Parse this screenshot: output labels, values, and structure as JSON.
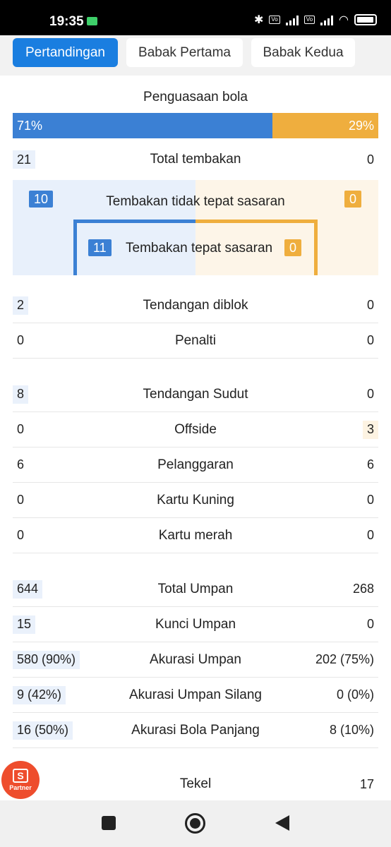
{
  "status_bar": {
    "time": "19:35"
  },
  "tabs": [
    {
      "label": "Pertandingan"
    },
    {
      "label": "Babak Pertama"
    },
    {
      "label": "Babak Kedua"
    }
  ],
  "possession": {
    "title": "Penguasaan bola",
    "home": "71%",
    "away": "29%",
    "home_fraction": 0.71
  },
  "total_shots": {
    "label": "Total tembakan",
    "home": "21",
    "away": "0"
  },
  "shots_off": {
    "label": "Tembakan tidak tepat sasaran",
    "home": "10",
    "away": "0"
  },
  "shots_on": {
    "label": "Tembakan tepat sasaran",
    "home": "11",
    "away": "0"
  },
  "stats_a": [
    {
      "label": "Tendangan diblok",
      "home": "2",
      "away": "0"
    },
    {
      "label": "Penalti",
      "home": "0",
      "away": "0"
    }
  ],
  "stats_b": [
    {
      "label": "Tendangan Sudut",
      "home": "8",
      "away": "0"
    },
    {
      "label": "Offside",
      "home": "0",
      "away": "3"
    },
    {
      "label": "Pelanggaran",
      "home": "6",
      "away": "6"
    },
    {
      "label": "Kartu Kuning",
      "home": "0",
      "away": "0"
    },
    {
      "label": "Kartu merah",
      "home": "0",
      "away": "0"
    }
  ],
  "stats_c": [
    {
      "label": "Total Umpan",
      "home": "644",
      "away": "268"
    },
    {
      "label": "Kunci Umpan",
      "home": "15",
      "away": "0"
    },
    {
      "label": "Akurasi Umpan",
      "home": "580 (90%)",
      "away": "202 (75%)"
    },
    {
      "label": "Akurasi Umpan Silang",
      "home": "9 (42%)",
      "away": "0 (0%)"
    },
    {
      "label": "Akurasi Bola Panjang",
      "home": "16 (50%)",
      "away": "8 (10%)"
    }
  ],
  "tackles": {
    "label": "Tekel",
    "away": "17"
  },
  "partner": {
    "logo": "S",
    "label": "Partner"
  }
}
